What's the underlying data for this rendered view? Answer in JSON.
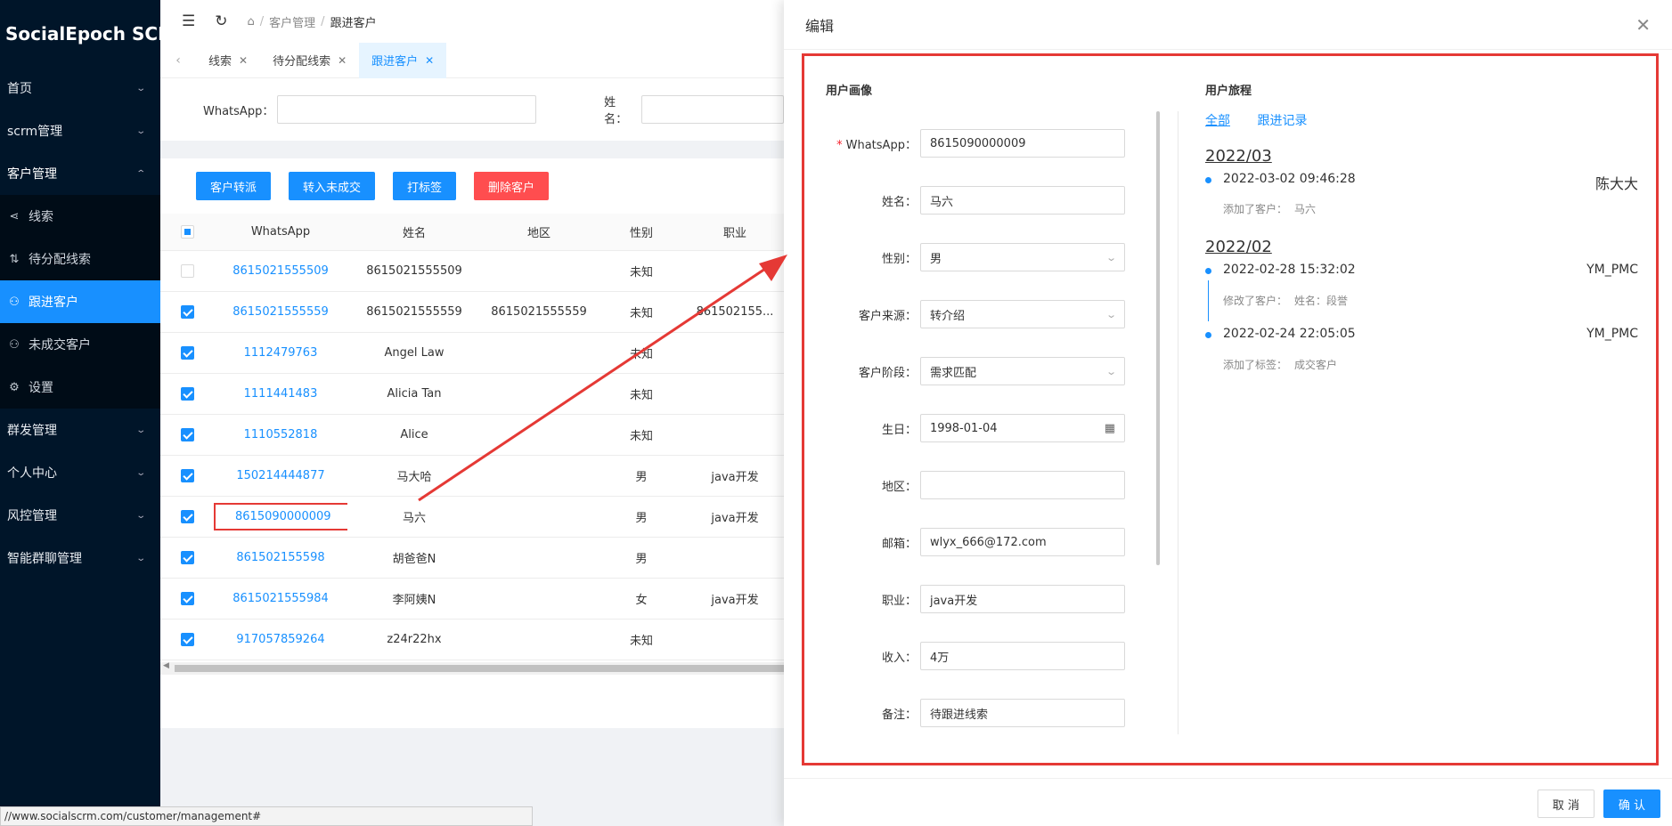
{
  "app": {
    "name": "SocialEpoch SCRM"
  },
  "sidebar": {
    "menu": [
      {
        "label": "首页"
      },
      {
        "label": "scrm管理"
      },
      {
        "label": "客户管理"
      }
    ],
    "submenu": [
      {
        "label": "线索",
        "icon": "share-icon"
      },
      {
        "label": "待分配线索",
        "icon": "transfer-icon"
      },
      {
        "label": "跟进客户",
        "icon": "user-icon"
      },
      {
        "label": "未成交客户",
        "icon": "user-icon"
      },
      {
        "label": "设置",
        "icon": "gear-icon"
      }
    ],
    "menu_after": [
      {
        "label": "群发管理"
      },
      {
        "label": "个人中心"
      },
      {
        "label": "风控管理"
      },
      {
        "label": "智能群聊管理"
      }
    ]
  },
  "breadcrumb": {
    "level1": "客户管理",
    "level2": "跟进客户"
  },
  "tabs": [
    {
      "label": "线索"
    },
    {
      "label": "待分配线索"
    },
    {
      "label": "跟进客户"
    }
  ],
  "filter": {
    "whatsapp_label": "WhatsApp",
    "name_label": "姓名"
  },
  "actions": {
    "transfer": "客户转派",
    "to_unclosed": "转入未成交",
    "tag": "打标签",
    "delete": "删除客户"
  },
  "table": {
    "headers": [
      "WhatsApp",
      "姓名",
      "地区",
      "性别",
      "职业"
    ],
    "rows": [
      {
        "whatsapp": "8615021555509",
        "name": "8615021555509",
        "region": "",
        "gender": "未知",
        "job": ""
      },
      {
        "whatsapp": "8615021555559",
        "name": "8615021555559",
        "region": "8615021555559",
        "gender": "未知",
        "job": "861502155..."
      },
      {
        "whatsapp": "1112479763",
        "name": "Angel Law",
        "region": "",
        "gender": "未知",
        "job": ""
      },
      {
        "whatsapp": "1111441483",
        "name": "Alicia Tan",
        "region": "",
        "gender": "未知",
        "job": ""
      },
      {
        "whatsapp": "1110552818",
        "name": "Alice",
        "region": "",
        "gender": "未知",
        "job": ""
      },
      {
        "whatsapp": "150214444877",
        "name": "马大哈",
        "region": "",
        "gender": "男",
        "job": "java开发"
      },
      {
        "whatsapp": "8615090000009",
        "name": "马六",
        "region": "",
        "gender": "男",
        "job": "java开发"
      },
      {
        "whatsapp": "861502155598",
        "name": "胡爸爸N",
        "region": "",
        "gender": "男",
        "job": ""
      },
      {
        "whatsapp": "8615021555984",
        "name": "李阿姨N",
        "region": "",
        "gender": "女",
        "job": "java开发"
      },
      {
        "whatsapp": "917057859264",
        "name": "z24r22hx",
        "region": "",
        "gender": "未知",
        "job": ""
      }
    ]
  },
  "status_url": "//www.socialscrm.com/customer/management#",
  "drawer": {
    "title": "编辑",
    "profile_title": "用户画像",
    "journey_title": "用户旅程",
    "fields": [
      {
        "label": "WhatsApp",
        "value": "8615090000009"
      },
      {
        "label": "姓名",
        "value": "马六"
      },
      {
        "label": "性别",
        "value": "男"
      },
      {
        "label": "客户来源",
        "value": "转介绍"
      },
      {
        "label": "客户阶段",
        "value": "需求匹配"
      },
      {
        "label": "生日",
        "value": "1998-01-04"
      },
      {
        "label": "地区",
        "value": ""
      },
      {
        "label": "邮箱",
        "value": "wlyx_666@172.com"
      },
      {
        "label": "职业",
        "value": "java开发"
      },
      {
        "label": "收入",
        "value": "4万"
      },
      {
        "label": "备注",
        "value": "待跟进线索"
      }
    ],
    "journey_tabs": [
      "全部",
      "跟进记录"
    ],
    "journey": {
      "month1": "2022/03",
      "e1": {
        "time": "2022-03-02 09:46:28",
        "user": "陈大大",
        "action": "添加了客户：",
        "value": "马六"
      },
      "month2": "2022/02",
      "e2": {
        "time": "2022-02-28 15:32:02",
        "user": "YM_PMC",
        "action": "修改了客户：",
        "value": "姓名：段誉"
      },
      "e3": {
        "time": "2022-02-24 22:05:05",
        "user": "YM_PMC",
        "action": "添加了标签：",
        "value": "成交客户"
      }
    },
    "cancel": "取 消",
    "confirm": "确 认"
  }
}
